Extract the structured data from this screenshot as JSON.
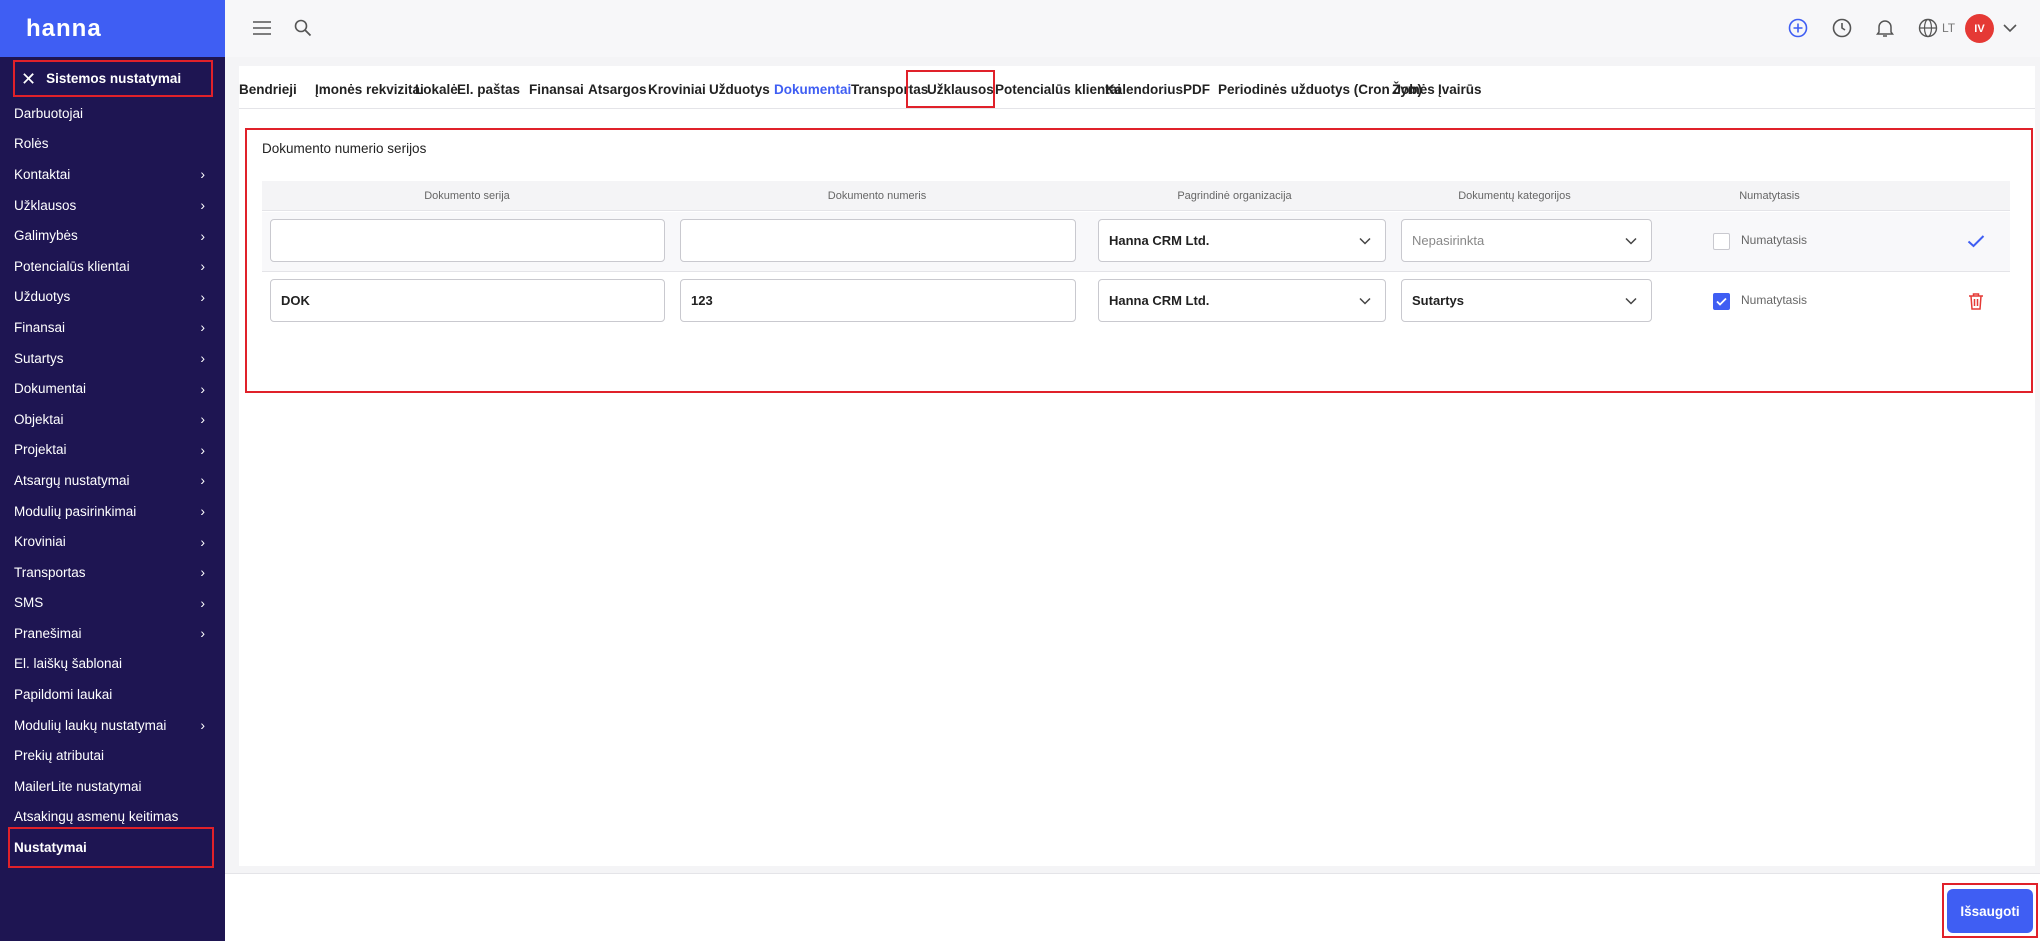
{
  "app": {
    "logo": "hanna"
  },
  "sidebar": {
    "header": "Sistemos nustatymai",
    "items": [
      {
        "label": "Darbuotojai",
        "chevron": false
      },
      {
        "label": "Rolės",
        "chevron": false
      },
      {
        "label": "Kontaktai",
        "chevron": true
      },
      {
        "label": "Užklausos",
        "chevron": true
      },
      {
        "label": "Galimybės",
        "chevron": true
      },
      {
        "label": "Potencialūs klientai",
        "chevron": true
      },
      {
        "label": "Užduotys",
        "chevron": true
      },
      {
        "label": "Finansai",
        "chevron": true
      },
      {
        "label": "Sutartys",
        "chevron": true
      },
      {
        "label": "Dokumentai",
        "chevron": true
      },
      {
        "label": "Objektai",
        "chevron": true
      },
      {
        "label": "Projektai",
        "chevron": true
      },
      {
        "label": "Atsargų nustatymai",
        "chevron": true
      },
      {
        "label": "Modulių pasirinkimai",
        "chevron": true
      },
      {
        "label": "Kroviniai",
        "chevron": true
      },
      {
        "label": "Transportas",
        "chevron": true
      },
      {
        "label": "SMS",
        "chevron": true
      },
      {
        "label": "Pranešimai",
        "chevron": true
      },
      {
        "label": "El. laiškų šablonai",
        "chevron": false
      },
      {
        "label": "Papildomi laukai",
        "chevron": false
      },
      {
        "label": "Modulių laukų nustatymai",
        "chevron": true
      },
      {
        "label": "Prekių atributai",
        "chevron": false
      },
      {
        "label": "MailerLite nustatymai",
        "chevron": false
      },
      {
        "label": "Atsakingų asmenų keitimas",
        "chevron": false
      },
      {
        "label": "Nustatymai",
        "chevron": false,
        "active": true
      }
    ]
  },
  "topbar": {
    "language": "LT",
    "avatar_initials": "IV",
    "icons": [
      "menu-icon",
      "search-icon",
      "add-circle-icon",
      "clock-icon",
      "bell-icon",
      "globe-icon",
      "chevron-down-icon"
    ]
  },
  "tabs": [
    {
      "label": "Bendrieji"
    },
    {
      "label": "Įmonės rekvizitai"
    },
    {
      "label": "Lokalė"
    },
    {
      "label": "El. paštas"
    },
    {
      "label": "Finansai"
    },
    {
      "label": "Atsargos"
    },
    {
      "label": "Kroviniai"
    },
    {
      "label": "Užduotys"
    },
    {
      "label": "Dokumentai",
      "active": true
    },
    {
      "label": "Transportas"
    },
    {
      "label": "Užklausos"
    },
    {
      "label": "Potencialūs klientai"
    },
    {
      "label": "Kalendorius"
    },
    {
      "label": "PDF"
    },
    {
      "label": "Periodinės užduotys (Cron Job)"
    },
    {
      "label": "Žymės"
    },
    {
      "label": "Įvairūs"
    }
  ],
  "section": {
    "title": "Dokumento numerio serijos",
    "columns": [
      "Dokumento serija",
      "Dokumento numeris",
      "Pagrindinė organizacija",
      "Dokumentų kategorijos",
      "Numatytasis"
    ],
    "rows": [
      {
        "series": "",
        "number": "",
        "organization": "Hanna CRM Ltd.",
        "category": "",
        "category_placeholder": "Nepasirinkta",
        "default_label": "Numatytasis",
        "is_default": false,
        "action": "confirm"
      },
      {
        "series": "DOK",
        "number": "123",
        "organization": "Hanna CRM Ltd.",
        "category": "Sutartys",
        "category_placeholder": "",
        "default_label": "Numatytasis",
        "is_default": true,
        "action": "delete"
      }
    ]
  },
  "footer": {
    "save_label": "Išsaugoti"
  },
  "colors": {
    "sidebar": "#1e1552",
    "accent": "#3f5ef3",
    "highlight": "#e0212a",
    "danger": "#e53935"
  }
}
